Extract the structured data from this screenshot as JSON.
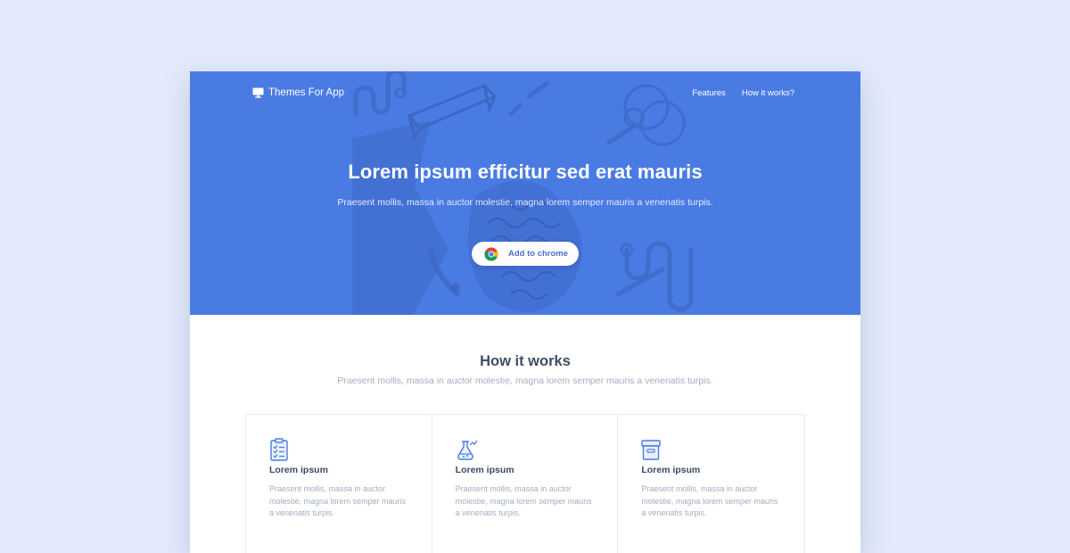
{
  "navbar": {
    "brand_name": "Themes For App",
    "brand_icon": "monitor-icon",
    "links": [
      {
        "label": "Features"
      },
      {
        "label": "How it works?"
      }
    ]
  },
  "hero": {
    "title": "Lorem ipsum efficitur sed erat mauris",
    "subtitle": "Praesent mollis, massa in auctor molestie, magna lorem semper mauris a venenatis turpis.",
    "cta_label": "Add to chrome",
    "cta_icon": "chrome-icon",
    "background_color": "#4a7be3"
  },
  "how_it_works": {
    "title": "How it works",
    "subtitle": "Praesent mollis, massa in auctor molestie, magna lorem semper mauris a venenatis turpis.",
    "cards": [
      {
        "icon": "checklist-icon",
        "title": "Lorem ipsum",
        "text": "Praesent mollis, massa in auctor molestie, magna lorem semper mauris a venenatis turpis."
      },
      {
        "icon": "flask-icon",
        "title": "Lorem ipsum",
        "text": "Praesent mollis, massa in auctor molestie, magna lorem semper mauris a venenatis turpis."
      },
      {
        "icon": "archive-box-icon",
        "title": "Lorem ipsum",
        "text": "Praesent mollis, massa in auctor molestie, magna lorem semper mauris a venenatis turpis."
      }
    ]
  },
  "colors": {
    "page_background": "#e3eafb",
    "accent": "#4a7be3",
    "heading_text": "#3f4d63",
    "muted_text": "#a3adbf"
  }
}
